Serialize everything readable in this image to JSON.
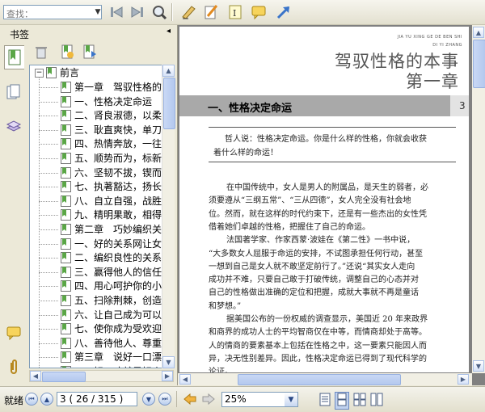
{
  "toolbar": {
    "search_placeholder": "查找：",
    "icons": [
      "prev-result-icon",
      "next-result-icon",
      "search-icon",
      "select-tool-icon",
      "highlight-icon",
      "text-note-icon",
      "comment-icon",
      "arrow-icon"
    ]
  },
  "sidebar": {
    "title": "书签",
    "collapse_glyph": "◂",
    "tabs": [
      "bookmarks-tab",
      "thumbnails-tab",
      "layers-tab",
      "annotations-tab",
      "attachments-tab"
    ]
  },
  "tree": {
    "root": "前言",
    "items": [
      {
        "label": "第一章　驾驭性格的本事",
        "top": true
      },
      {
        "label": "一、性格决定命运",
        "top": false
      },
      {
        "label": "二、肾良淑德，以柔",
        "top": false
      },
      {
        "label": "三、耿直爽快，单刀",
        "top": false
      },
      {
        "label": "四、热情奔放，一往",
        "top": false
      },
      {
        "label": "五、顺势而为，标新",
        "top": false
      },
      {
        "label": "六、坚韧不拔，锲而",
        "top": false
      },
      {
        "label": "七、执著豁达，扬长",
        "top": false
      },
      {
        "label": "八、自立自强，战胜",
        "top": false
      },
      {
        "label": "九、精明果敢，相得",
        "top": false
      },
      {
        "label": "第二章　巧妙编织关系",
        "top": true
      },
      {
        "label": "一、好的关系网让女",
        "top": false
      },
      {
        "label": "二、编织良性的关系",
        "top": false
      },
      {
        "label": "三、赢得他人的信任",
        "top": false
      },
      {
        "label": "四、用心呵护你的小",
        "top": false
      },
      {
        "label": "五、扫除荆棘，创造",
        "top": false
      },
      {
        "label": "六、让自己成为可以",
        "top": false
      },
      {
        "label": "七、使你成为受欢迎",
        "top": false
      },
      {
        "label": "八、善待他人、尊重",
        "top": false
      },
      {
        "label": "第三章　说好一口漂亮话",
        "top": true
      },
      {
        "label": "一、好口才就是好人",
        "top": false
      }
    ]
  },
  "document": {
    "pinyin_line1": "JIA YU XING GE DE BEN SHI",
    "pinyin_line2": "DI YI ZHANG",
    "book_title": "驾驭性格的本事",
    "chapter_title": "第一章",
    "section_title": "一、性格决定命运",
    "page_number": "3",
    "quote": [
      "哲人说：性格决定命运。你是什么样的性格，你就会收获",
      "着什么样的命运！"
    ],
    "paragraphs": [
      "在中国传统中，女人是男人的附属品，是天生的弱者，必",
      "须要遵从“三纲五常”、“三从四德”，女人完全没有社会地",
      "位。然而，就在这样的时代约束下，还是有一些杰出的女性凭",
      "借着她们卓越的性格，把握住了自己的命运。",
      "法国著学家、作家西蒙·波娃在《第二性》一书中说，",
      "“大多数女人屈服于命运的安排，不试图承担任何行动，甚至",
      "一想到自己是女人就不敢坚定前行了。”还说“其实女人走向",
      "成功并不难，只要自己敢于打破传统，调整自己的心态并对",
      "自己的性格做出准确的定位和把握，成就大事就不再是童话",
      "和梦想。”",
      "据美国公布的一份权威的调查显示，美国近 20 年来政界",
      "和商界的成功人士的平均智商仅在中等，而情商却处于高等。",
      "人的情商的要素基本上包括在性格之中，这一要素只能因人而",
      "异，决无性别差异。因此，性格决定命运已得到了现代科学的",
      "论证。"
    ]
  },
  "statusbar": {
    "ready_label": "就绪",
    "page_field": "3 ( 26 / 315 )",
    "zoom_value": "25%",
    "view_mode_icons": [
      "single-page-icon",
      "continuous-page-icon",
      "facing-pages-icon",
      "continuous-facing-icon"
    ]
  }
}
